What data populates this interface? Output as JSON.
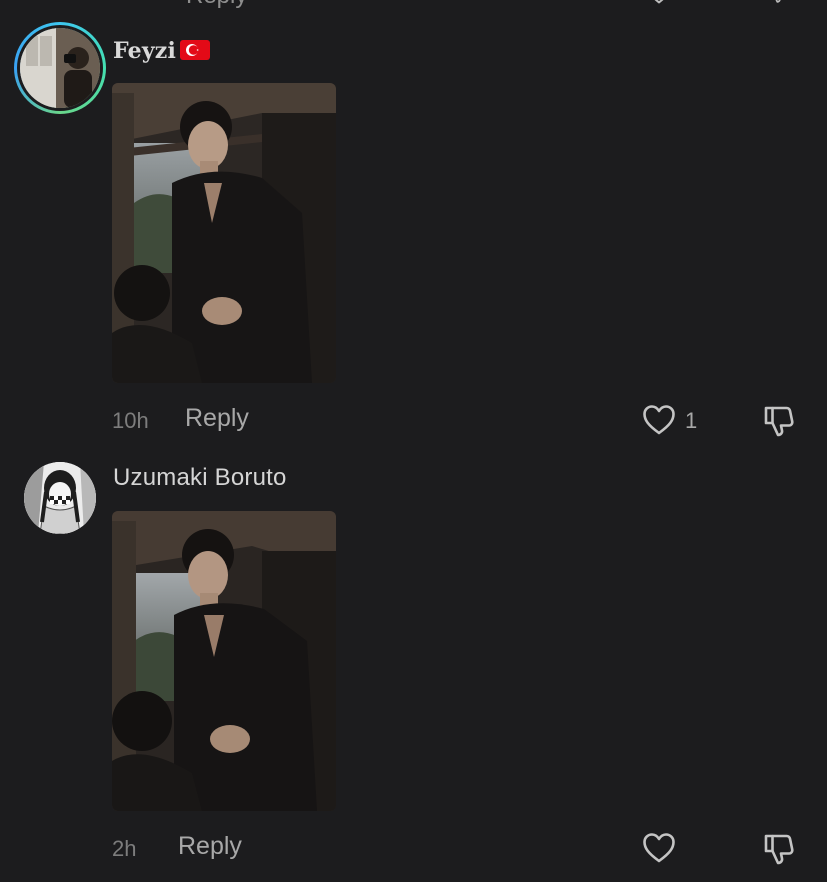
{
  "previous_comment": {
    "reply_label": "Reply"
  },
  "comments": [
    {
      "username": "Feyzi",
      "flag": "🇹🇷",
      "has_story_ring": true,
      "time": "10h",
      "reply_label": "Reply",
      "like_count": "1"
    },
    {
      "username": "Uzumaki Boruto",
      "has_story_ring": false,
      "time": "2h",
      "reply_label": "Reply",
      "like_count": ""
    }
  ],
  "icons": {
    "like": "heart-outline-icon",
    "dislike": "thumbs-down-outline-icon"
  },
  "colors": {
    "background": "#1c1c1e",
    "text_primary": "#d9d9d9",
    "text_secondary": "#7d7d7d",
    "story_ring": "#3ec7f0"
  }
}
